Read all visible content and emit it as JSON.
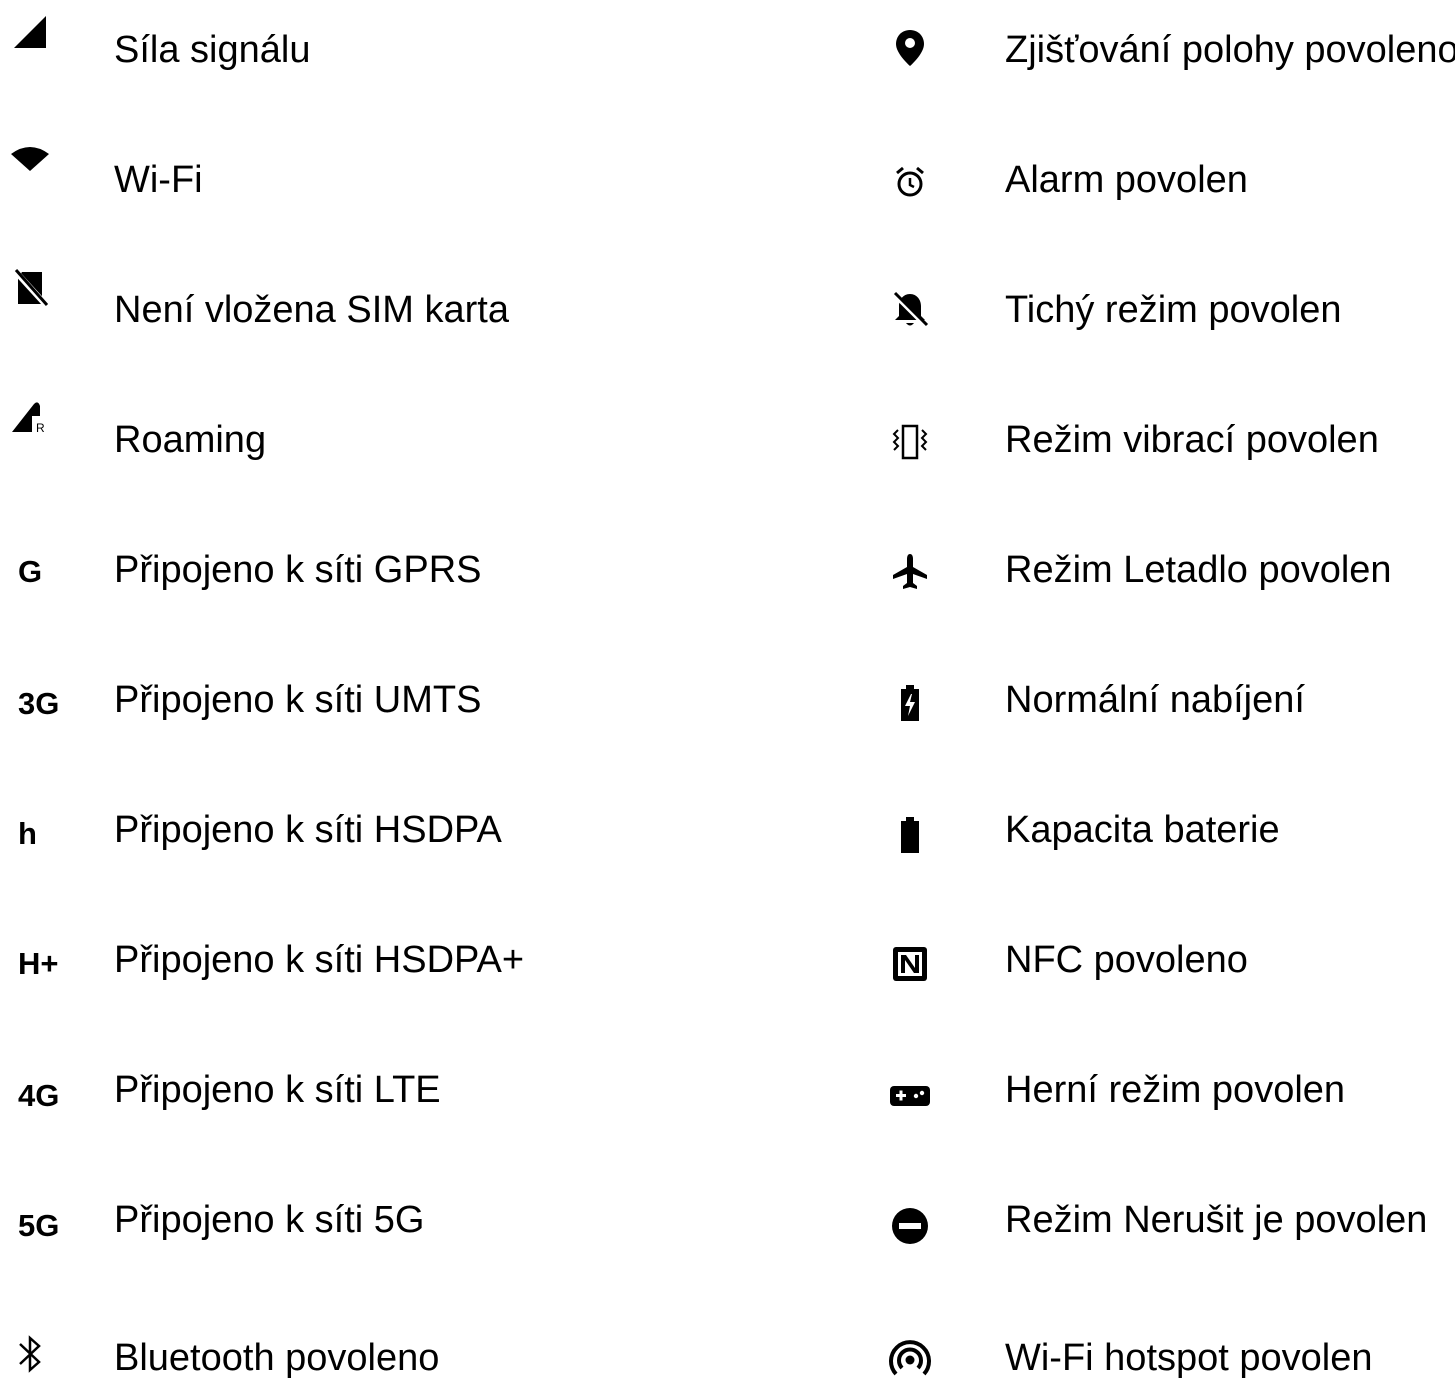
{
  "left_items": [
    {
      "icon": "signal-strength-icon",
      "label": "Síla signálu"
    },
    {
      "icon": "wifi-icon",
      "label": "Wi-Fi"
    },
    {
      "icon": "no-sim-icon",
      "label": "Není vložena SIM karta"
    },
    {
      "icon": "roaming-icon",
      "label": "Roaming"
    },
    {
      "icon_text": "G",
      "label": "Připojeno k síti GPRS"
    },
    {
      "icon_text": "3G",
      "label": "Připojeno k síti UMTS"
    },
    {
      "icon_text": "h",
      "label": "Připojeno k síti HSDPA"
    },
    {
      "icon_text": "H+",
      "label": "Připojeno k síti HSDPA+"
    },
    {
      "icon_text": "4G",
      "label": "Připojeno k síti LTE"
    },
    {
      "icon_text": "5G",
      "label": "Připojeno k síti 5G"
    },
    {
      "icon": "bluetooth-icon",
      "label": "Bluetooth povoleno"
    }
  ],
  "right_items": [
    {
      "icon": "location-pin-icon",
      "label": "Zjišťování polohy povoleno"
    },
    {
      "icon": "alarm-clock-icon",
      "label": "Alarm povolen"
    },
    {
      "icon": "bell-off-icon",
      "label": "Tichý režim povolen"
    },
    {
      "icon": "vibrate-icon",
      "label": "Režim vibrací povolen"
    },
    {
      "icon": "airplane-icon",
      "label": "Režim Letadlo povolen"
    },
    {
      "icon": "battery-charging-icon",
      "label": "Normální nabíjení"
    },
    {
      "icon": "battery-full-icon",
      "label": "Kapacita baterie"
    },
    {
      "icon": "nfc-icon",
      "label": "NFC povoleno"
    },
    {
      "icon": "gamepad-icon",
      "label": "Herní režim povolen"
    },
    {
      "icon": "do-not-disturb-icon",
      "label": "Režim Nerušit je povolen"
    },
    {
      "icon": "hotspot-icon",
      "label": "Wi-Fi hotspot povolen"
    }
  ]
}
